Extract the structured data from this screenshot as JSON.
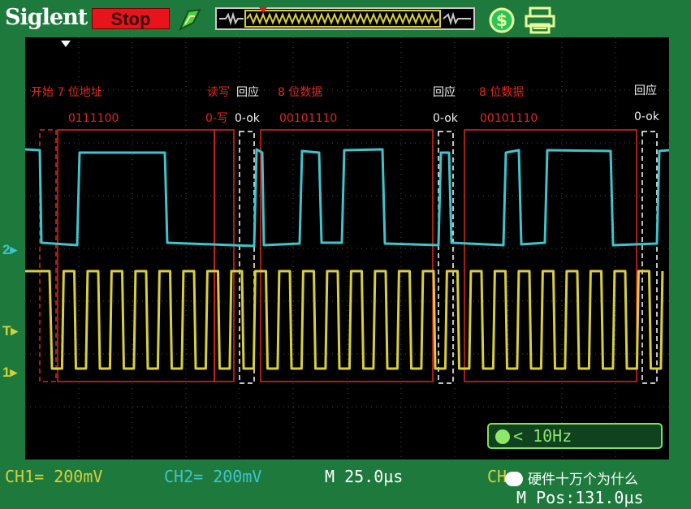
{
  "header": {
    "brand": "Siglent",
    "run_state": "Stop"
  },
  "annotations": {
    "start_addr_label": "开始 7 位地址",
    "addr_value": "0111100",
    "rw_label": "读写",
    "rw_value": "0-写",
    "ack1_label": "回应",
    "ack1_value": "0-ok",
    "data1_label": "8 位数据",
    "data1_value": "00101110",
    "ack2_label": "回应",
    "ack2_value": "0-ok",
    "data2_label": "8 位数据",
    "data2_value": "00101110",
    "ack3_label": "回应",
    "ack3_value": "0-ok"
  },
  "markers": {
    "ch2": "2",
    "trigger": "T",
    "ch1": "1"
  },
  "trigger_readout": "< 10Hz",
  "footer": {
    "ch1": "CH1= 200mV",
    "ch2": "CH2= 200mV",
    "timebase": "M 25.0µs",
    "ch_partial": "CH",
    "m_pos": "M Pos:131.0µs"
  },
  "watermark": "硬件十万个为什么",
  "colors": {
    "ch1": "#d8cf3a",
    "ch2": "#3fc3cc",
    "frame_bg": "#1d7a3c",
    "annotation_red": "#e0281e",
    "stop_red": "#e8141c"
  },
  "icons": [
    "trigger-green-icon",
    "timebase-window-icon",
    "dollar-icon",
    "print-icon"
  ]
}
